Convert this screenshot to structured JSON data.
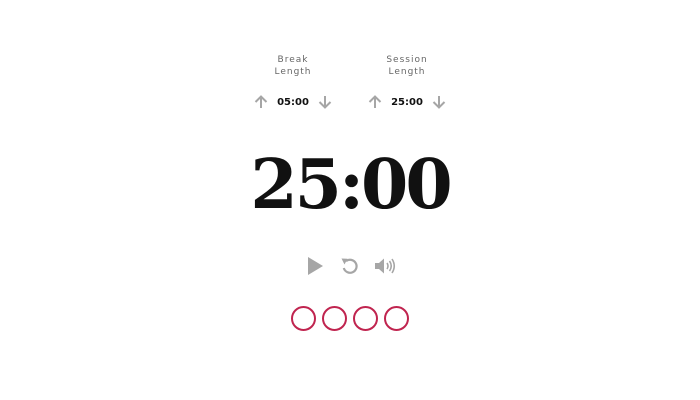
{
  "break": {
    "label_line1": "Break",
    "label_line2": "Length",
    "value": "05:00",
    "increment_icon": "arrow-up-icon",
    "decrement_icon": "arrow-down-icon"
  },
  "session": {
    "label_line1": "Session",
    "label_line2": "Length",
    "value": "25:00",
    "increment_icon": "arrow-up-icon",
    "decrement_icon": "arrow-down-icon"
  },
  "timer": {
    "display": "25:00"
  },
  "controls": {
    "play_icon": "play-icon",
    "reset_icon": "reset-icon",
    "sound_icon": "volume-icon"
  },
  "session_indicators": {
    "count": 4,
    "completed": 0,
    "color": "#c0244f"
  },
  "colors": {
    "icon_gray": "#a6a6a6",
    "text_dark": "#111111",
    "label_gray": "#666666",
    "accent": "#c0244f"
  }
}
